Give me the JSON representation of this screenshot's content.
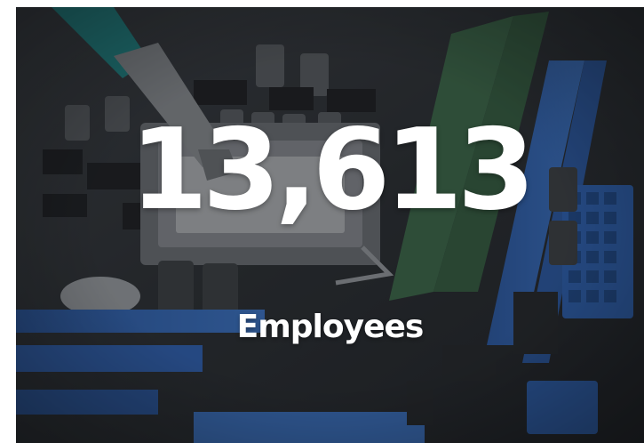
{
  "stat": {
    "number": "13,613",
    "label": "Employees"
  },
  "background": {
    "icon": "motherboard-photo",
    "colors": {
      "board": "#2b2e33",
      "slot_blue": "#2f63b8",
      "ram_green": "#3f6b4a",
      "syringe_teal": "#1f8a8a"
    }
  }
}
